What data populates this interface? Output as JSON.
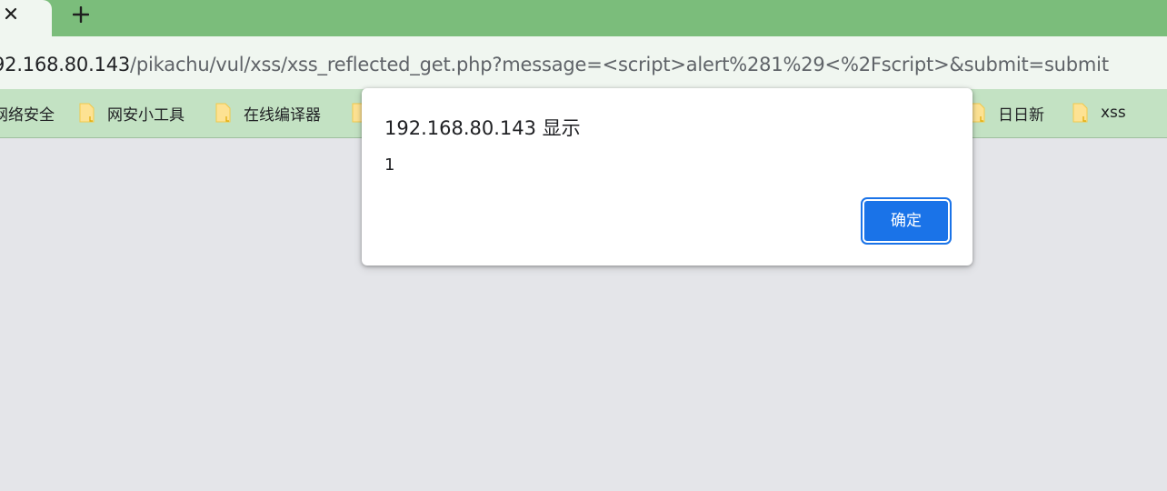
{
  "tab": {
    "close_icon": "close-icon",
    "new_tab_icon": "plus-icon"
  },
  "address_bar": {
    "host": "92.168.80.143",
    "path": "/pikachu/vul/xss/xss_reflected_get.php?message=<script>alert%281%29<%2Fscript>&submit=submit"
  },
  "bookmarks": {
    "items": [
      {
        "label": "网络安全",
        "icon": null
      },
      {
        "label": "网安小工具",
        "icon": "folder-icon"
      },
      {
        "label": "在线编译器",
        "icon": "folder-icon"
      },
      {
        "label": "",
        "icon": "folder-icon"
      },
      {
        "label": "",
        "icon": "folder-icon"
      },
      {
        "label": "日日新",
        "icon": "folder-icon"
      },
      {
        "label": "xss",
        "icon": "folder-icon"
      }
    ]
  },
  "dialog": {
    "title": "192.168.80.143 显示",
    "message": "1",
    "ok_label": "确定"
  },
  "colors": {
    "tabstrip": "#7bbd7b",
    "toolbar": "#f0f6f0",
    "bookmarks_bar": "#c3e2c3",
    "page_bg": "#e4e5e9",
    "folder": "#fde293",
    "accent": "#1a73e8"
  }
}
